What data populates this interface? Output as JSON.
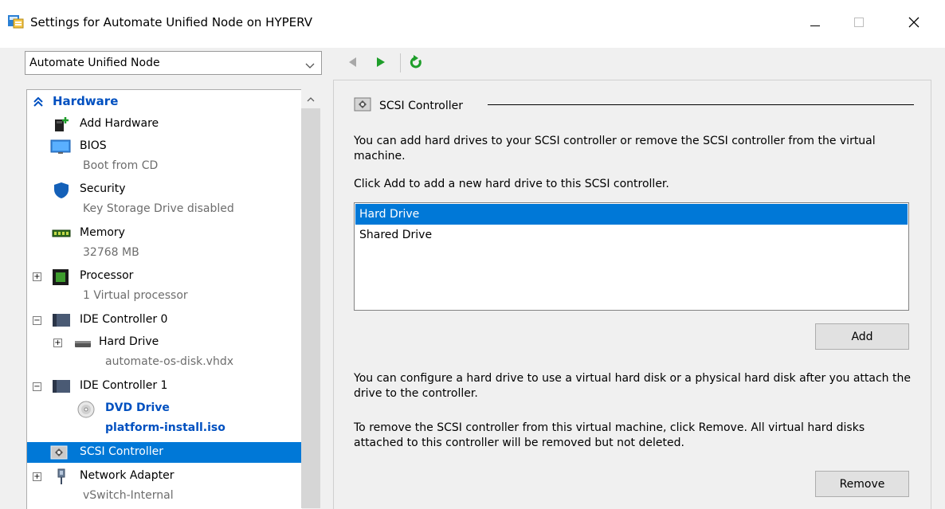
{
  "window": {
    "title": "Settings for Automate Unified Node on HYPERV",
    "minimize_icon": "minimize-icon",
    "maximize_icon": "maximize-icon",
    "close_icon": "close-icon"
  },
  "vm_selector": {
    "value": "Automate Unified Node"
  },
  "nav": {
    "back_icon": "back-arrow-icon",
    "forward_icon": "forward-arrow-icon",
    "refresh_icon": "refresh-icon"
  },
  "tree": {
    "section": "Hardware",
    "items": [
      {
        "label": "Add Hardware",
        "icon": "add-hardware-icon"
      },
      {
        "label": "BIOS",
        "sub": "Boot from CD",
        "icon": "bios-icon"
      },
      {
        "label": "Security",
        "sub": "Key Storage Drive disabled",
        "icon": "shield-icon"
      },
      {
        "label": "Memory",
        "sub": "32768 MB",
        "icon": "memory-icon"
      },
      {
        "label": "Processor",
        "sub": "1 Virtual processor",
        "icon": "processor-icon",
        "expander": "+"
      },
      {
        "label": "IDE Controller 0",
        "icon": "ide-controller-icon",
        "expander": "−"
      },
      {
        "label": "Hard Drive",
        "sub": "automate-os-disk.vhdx",
        "icon": "hard-drive-icon",
        "expander": "+"
      },
      {
        "label": "IDE Controller 1",
        "icon": "ide-controller-icon",
        "expander": "−"
      },
      {
        "label": "DVD Drive",
        "sub": "platform-install.iso",
        "icon": "dvd-icon"
      },
      {
        "label": "SCSI Controller",
        "icon": "scsi-controller-icon"
      },
      {
        "label": "Network Adapter",
        "sub": "vSwitch-Internal",
        "icon": "network-adapter-icon",
        "expander": "+"
      }
    ]
  },
  "panel": {
    "title": "SCSI Controller",
    "intro": "You can add hard drives to your SCSI controller or remove the SCSI controller from the virtual machine.",
    "instruction": "Click Add to add a new hard drive to this SCSI controller.",
    "list": [
      "Hard Drive",
      "Shared Drive"
    ],
    "add_label": "Add",
    "configure_text": "You can configure a hard drive to use a virtual hard disk or a physical hard disk after you attach the drive to the controller.",
    "remove_text": "To remove the SCSI controller from this virtual machine, click Remove. All virtual hard disks attached to this controller will be removed but not deleted.",
    "remove_label": "Remove"
  },
  "colors": {
    "selection": "#0078d7",
    "link_blue": "#0050c0",
    "forward_green": "#1e9e2a"
  }
}
